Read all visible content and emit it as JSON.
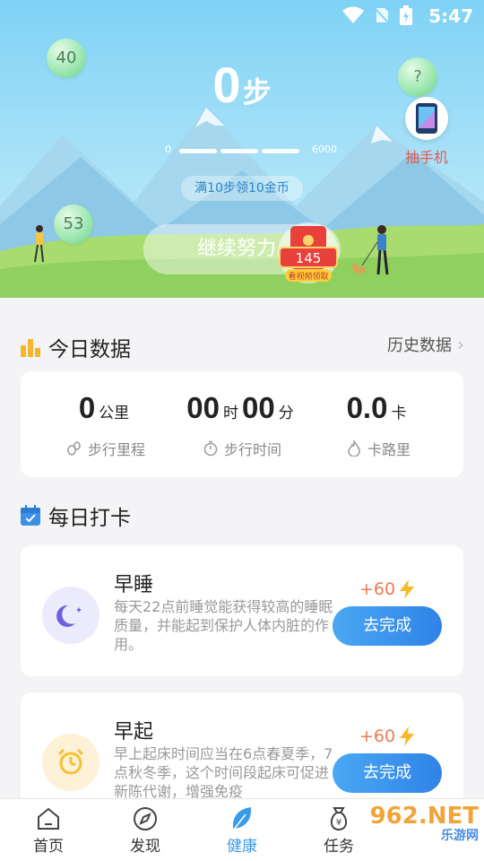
{
  "status": {
    "time": "5:47"
  },
  "hero": {
    "steps": "0",
    "steps_unit": "步",
    "progress_min": "0",
    "progress_max": "6000",
    "hint": "满10步领10金币",
    "bubble_a": "40",
    "bubble_b": "53",
    "bubble_help": "?",
    "prize_label": "抽手机",
    "continue_label": "继续努力",
    "redpack_value": "145",
    "redpack_caption": "看视频领取"
  },
  "today": {
    "title": "今日数据",
    "history": "历史数据",
    "distance": {
      "value": "0",
      "unit": "公里",
      "label": "步行里程"
    },
    "time": {
      "hours": "00",
      "h_unit": "时",
      "minutes": "00",
      "m_unit": "分",
      "label": "步行时间"
    },
    "calories": {
      "value": "0.0",
      "unit": "卡",
      "label": "卡路里"
    }
  },
  "checkin": {
    "title": "每日打卡",
    "tasks": [
      {
        "title": "早睡",
        "desc": "每天22点前睡觉能获得较高的睡眠质量，并能起到保护人体内脏的作用。",
        "reward": "+60",
        "button": "去完成"
      },
      {
        "title": "早起",
        "desc": "早上起床时间应当在6点春夏季，7点秋冬季，这个时间段起床可促进新陈代谢，增强免疫",
        "reward": "+60",
        "button": "去完成"
      }
    ]
  },
  "tabs": [
    {
      "label": "首页",
      "icon": "home-icon"
    },
    {
      "label": "发现",
      "icon": "compass-icon"
    },
    {
      "label": "健康",
      "icon": "leaf-icon"
    },
    {
      "label": "任务",
      "icon": "money-bag-icon"
    }
  ],
  "active_tab": "健康",
  "watermark": {
    "main": "962.NET",
    "sub": "乐游网"
  },
  "colors": {
    "accent": "#3a9be8",
    "reward": "#ee7a55",
    "sky": "#7fd2f5",
    "grass": "#8fd05f"
  }
}
